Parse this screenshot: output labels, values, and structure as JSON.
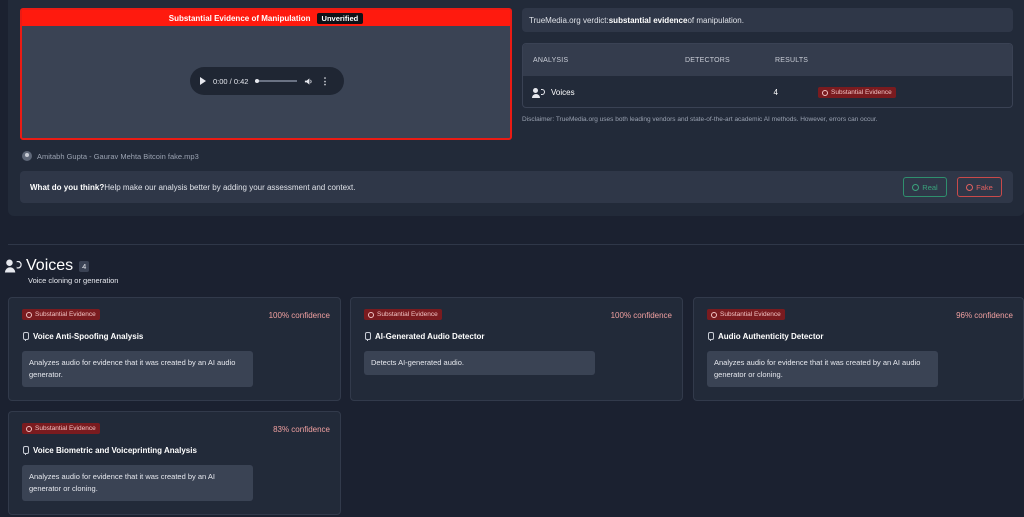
{
  "media": {
    "header_title": "Substantial Evidence of Manipulation",
    "status_badge": "Unverified",
    "audio_time": "0:00 / 0:42",
    "file_name": "Amitabh Gupta - Gaurav Mehta Bitcoin fake.mp3"
  },
  "verdict": {
    "prefix": "TrueMedia.org verdict: ",
    "strong": "substantial evidence",
    "suffix": " of manipulation."
  },
  "analysis_table": {
    "headers": [
      "ANALYSIS",
      "DETECTORS",
      "RESULTS"
    ],
    "row": {
      "analysis": "Voices",
      "detectors": "4",
      "result": "Substantial Evidence"
    }
  },
  "disclaimer": "Disclaimer: TrueMedia.org uses both leading vendors and state-of-the-art academic AI methods. However, errors can occur.",
  "feedback": {
    "question": "What do you think?",
    "text": " Help make our analysis better by adding your assessment and context.",
    "real_label": "Real",
    "fake_label": "Fake"
  },
  "section": {
    "title": "Voices",
    "count": "4",
    "subtitle": "Voice cloning or generation"
  },
  "cards": [
    {
      "badge": "Substantial Evidence",
      "confidence": "100% confidence",
      "title": "Voice Anti-Spoofing Analysis",
      "description": "Analyzes audio for evidence that it was created by an AI audio generator."
    },
    {
      "badge": "Substantial Evidence",
      "confidence": "100% confidence",
      "title": "AI-Generated Audio Detector",
      "description": "Detects AI-generated audio."
    },
    {
      "badge": "Substantial Evidence",
      "confidence": "96% confidence",
      "title": "Audio Authenticity Detector",
      "description": "Analyzes audio for evidence that it was created by an AI audio generator or cloning."
    },
    {
      "badge": "Substantial Evidence",
      "confidence": "83% confidence",
      "title": "Voice Biometric and Voiceprinting Analysis",
      "description": "Analyzes audio for evidence that it was created by an AI generator or cloning."
    }
  ],
  "colors": {
    "manipulation_red": "#ff1a0e",
    "badge_red": "#7a1b1f",
    "real_green": "#3aa37c",
    "fake_red": "#e06060"
  }
}
